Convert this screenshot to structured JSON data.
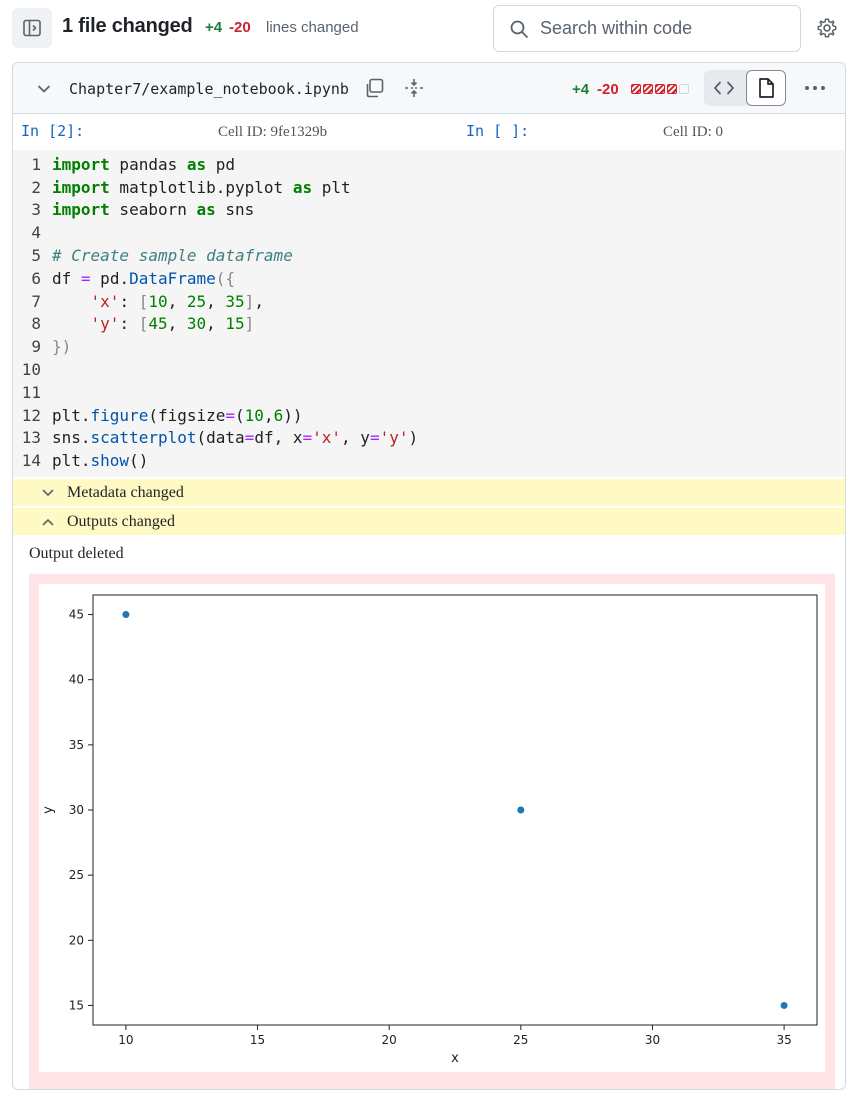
{
  "header": {
    "files_changed": "1 file changed",
    "additions": "+4",
    "deletions": "-20",
    "lines_changed_label": "lines changed",
    "search_placeholder": "Search within code"
  },
  "file": {
    "path": "Chapter7/example_notebook.ipynb",
    "additions": "+4",
    "deletions": "-20",
    "diffstat_blocks": [
      "deleted",
      "deleted",
      "deleted",
      "deleted",
      "neutral"
    ]
  },
  "cells": {
    "left_prompt": "In [2]:",
    "left_cell_id": "Cell ID: 9fe1329b",
    "right_prompt": "In [ ]:",
    "right_cell_id": "Cell ID: 0"
  },
  "code_lines": [
    {
      "n": "1",
      "tokens": [
        [
          "kw",
          "import"
        ],
        [
          "",
          " pandas "
        ],
        [
          "kw",
          "as"
        ],
        [
          "",
          " pd"
        ]
      ]
    },
    {
      "n": "2",
      "tokens": [
        [
          "kw",
          "import"
        ],
        [
          "",
          " matplotlib.pyplot "
        ],
        [
          "kw",
          "as"
        ],
        [
          "",
          " plt"
        ]
      ]
    },
    {
      "n": "3",
      "tokens": [
        [
          "kw",
          "import"
        ],
        [
          "",
          " seaborn "
        ],
        [
          "kw",
          "as"
        ],
        [
          "",
          " sns"
        ]
      ]
    },
    {
      "n": "4",
      "tokens": []
    },
    {
      "n": "5",
      "tokens": [
        [
          "cm",
          "# Create sample dataframe"
        ]
      ]
    },
    {
      "n": "6",
      "tokens": [
        [
          "",
          "df "
        ],
        [
          "op",
          "="
        ],
        [
          "",
          " pd."
        ],
        [
          "fn",
          "DataFrame"
        ],
        [
          "br",
          "({"
        ]
      ]
    },
    {
      "n": "7",
      "tokens": [
        [
          "",
          "    "
        ],
        [
          "st",
          "'x'"
        ],
        [
          "",
          ": "
        ],
        [
          "br",
          "["
        ],
        [
          "nm",
          "10"
        ],
        [
          "",
          ", "
        ],
        [
          "nm",
          "25"
        ],
        [
          "",
          ", "
        ],
        [
          "nm",
          "35"
        ],
        [
          "br",
          "]"
        ],
        [
          "",
          ","
        ]
      ]
    },
    {
      "n": "8",
      "tokens": [
        [
          "",
          "    "
        ],
        [
          "st",
          "'y'"
        ],
        [
          "",
          ": "
        ],
        [
          "br",
          "["
        ],
        [
          "nm",
          "45"
        ],
        [
          "",
          ", "
        ],
        [
          "nm",
          "30"
        ],
        [
          "",
          ", "
        ],
        [
          "nm",
          "15"
        ],
        [
          "br",
          "]"
        ]
      ]
    },
    {
      "n": "9",
      "tokens": [
        [
          "br",
          "})"
        ]
      ]
    },
    {
      "n": "10",
      "tokens": []
    },
    {
      "n": "11",
      "tokens": []
    },
    {
      "n": "12",
      "tokens": [
        [
          "",
          "plt."
        ],
        [
          "fn",
          "figure"
        ],
        [
          "",
          "(figsize"
        ],
        [
          "op",
          "="
        ],
        [
          "",
          "("
        ],
        [
          "nm",
          "10"
        ],
        [
          "",
          ","
        ],
        [
          "nm",
          "6"
        ],
        [
          "",
          "))"
        ]
      ]
    },
    {
      "n": "13",
      "tokens": [
        [
          "",
          "sns."
        ],
        [
          "fn",
          "scatterplot"
        ],
        [
          "",
          "(data"
        ],
        [
          "op",
          "="
        ],
        [
          "",
          "df, x"
        ],
        [
          "op",
          "="
        ],
        [
          "st",
          "'x'"
        ],
        [
          "",
          ", y"
        ],
        [
          "op",
          "="
        ],
        [
          "st",
          "'y'"
        ],
        [
          "",
          ")"
        ]
      ]
    },
    {
      "n": "14",
      "tokens": [
        [
          "",
          "plt."
        ],
        [
          "fn",
          "show"
        ],
        [
          "",
          "()"
        ]
      ]
    }
  ],
  "sections": {
    "metadata_label": "Metadata changed",
    "outputs_label": "Outputs changed",
    "output_status": "Output deleted"
  },
  "colors": {
    "addition": "#1a7f37",
    "deletion": "#cf222e",
    "point": "#1f77b4",
    "deleted_output_bg": "#ffe5e5",
    "section_bar_bg": "#fff9c4"
  },
  "chart_data": {
    "type": "scatter",
    "x": [
      10,
      25,
      35
    ],
    "y": [
      45,
      30,
      15
    ],
    "xlabel": "x",
    "ylabel": "y",
    "xticks": [
      10,
      15,
      20,
      25,
      30,
      35
    ],
    "yticks": [
      15,
      20,
      25,
      30,
      35,
      40,
      45
    ],
    "xlim": [
      8.75,
      36.25
    ],
    "ylim": [
      13.5,
      46.5
    ],
    "grid": false
  }
}
